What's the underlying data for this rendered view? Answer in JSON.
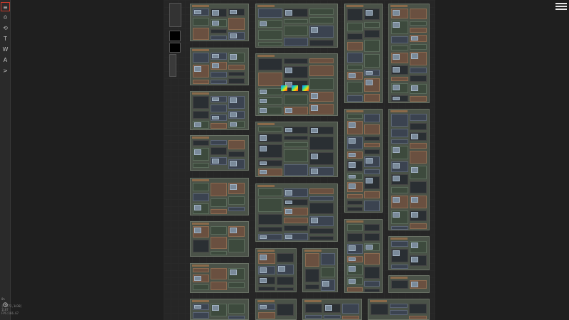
{
  "toolbar": {
    "items": [
      {
        "name": "menu",
        "label": "≡"
      },
      {
        "name": "home",
        "label": "⌂"
      },
      {
        "name": "history",
        "label": "⟲"
      },
      {
        "name": "text",
        "label": "T"
      },
      {
        "name": "workflow",
        "label": "W"
      },
      {
        "name": "assets",
        "label": "A"
      },
      {
        "name": "console",
        "label": ">"
      }
    ]
  },
  "stats": {
    "lines": [
      "0%",
      "[-2772,1430]",
      "1187",
      "FPS:166.67"
    ]
  },
  "colors": {
    "background": "#1f1f1f",
    "canvas": "#262626",
    "group": "#4a5248",
    "node": "#3b4350",
    "accent": "#c0392b"
  }
}
